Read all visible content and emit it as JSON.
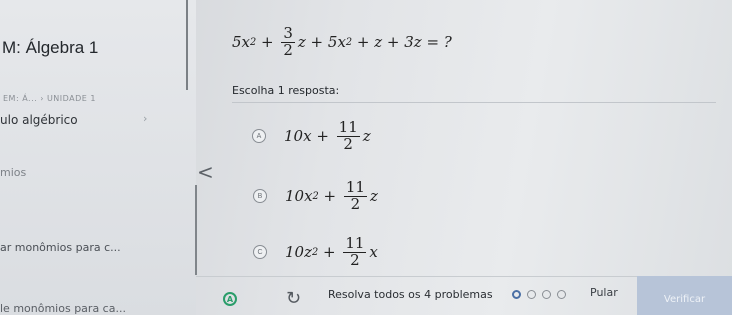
{
  "sidebar": {
    "course_title": "M: Álgebra 1",
    "breadcrumb": "EM: Á... › UNIDADE 1",
    "topic": "ulo algébrico",
    "chevron": "›",
    "exercises_label": "mios",
    "collapse": "<",
    "exercise_1": "ar monômios para c...",
    "exercise_2": "le monômios para ca..."
  },
  "question": {
    "part1": "5x",
    "exp1": "2",
    "op1": " + ",
    "frac_num": "3",
    "frac_den": "2",
    "part2": "z + 5x",
    "exp2": "2",
    "part3": " + z + 3z = ?"
  },
  "prompt": "Escolha 1 resposta:",
  "choices": [
    {
      "letter": "A",
      "lead": "10x + ",
      "num": "11",
      "den": "2",
      "tail": "z"
    },
    {
      "letter": "B",
      "lead": "10x",
      "exp": "2",
      "plus": " + ",
      "num": "11",
      "den": "2",
      "tail": "z"
    },
    {
      "letter": "C",
      "lead": "10z",
      "exp": "2",
      "plus": " + ",
      "num": "11",
      "den": "2",
      "tail": "x"
    }
  ],
  "footer": {
    "icon1_letter": "A",
    "icon1": "hint-icon",
    "icon2": "refresh-icon",
    "progress_text": "Resolva todos os 4 problemas",
    "dots_total": 4,
    "dots_current": 1,
    "skip_label": "Pular",
    "check_label": "Verificar"
  },
  "colors": {
    "accent_green": "#2a9d6a",
    "button_disabled": "#b7c4d8"
  }
}
